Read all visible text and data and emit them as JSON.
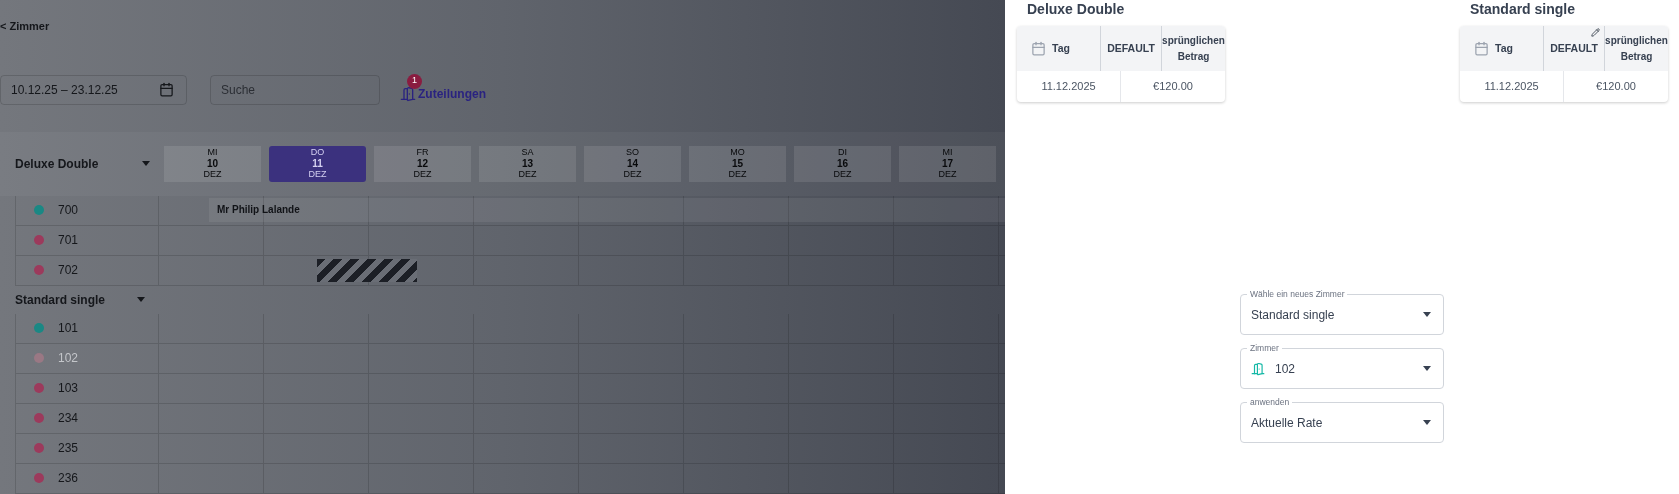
{
  "back_link": "< Zimmer",
  "toolbar": {
    "date_range": "10.12.25 – 23.12.25",
    "search": {
      "placeholder": "Suche"
    },
    "assignments": {
      "label": "Zuteilungen",
      "badge": "1"
    }
  },
  "calendar": {
    "days": [
      {
        "weekday": "MI",
        "day": "10",
        "month": "DEZ",
        "selected": false
      },
      {
        "weekday": "DO",
        "day": "11",
        "month": "DEZ",
        "selected": true
      },
      {
        "weekday": "FR",
        "day": "12",
        "month": "DEZ",
        "selected": false
      },
      {
        "weekday": "SA",
        "day": "13",
        "month": "DEZ",
        "selected": false
      },
      {
        "weekday": "SO",
        "day": "14",
        "month": "DEZ",
        "selected": false
      },
      {
        "weekday": "MO",
        "day": "15",
        "month": "DEZ",
        "selected": false
      },
      {
        "weekday": "DI",
        "day": "16",
        "month": "DEZ",
        "selected": false
      },
      {
        "weekday": "MI",
        "day": "17",
        "month": "DEZ",
        "selected": false
      }
    ],
    "groups": [
      {
        "name": "Deluxe Double",
        "rooms": [
          {
            "number": "700",
            "color": "#1a8884",
            "disabled": false,
            "blocked": false,
            "booking": "Mr Philip Lalande"
          },
          {
            "number": "701",
            "color": "#9c3a5c",
            "disabled": false,
            "blocked": false
          },
          {
            "number": "702",
            "color": "#9c3a5c",
            "disabled": false,
            "blocked": true
          }
        ]
      },
      {
        "name": "Standard single",
        "rooms": [
          {
            "number": "101",
            "color": "#1a8884",
            "disabled": false,
            "blocked": false
          },
          {
            "number": "102",
            "color": "#9a7884",
            "disabled": true,
            "blocked": false
          },
          {
            "number": "103",
            "color": "#9c3a5c",
            "disabled": false,
            "blocked": false
          },
          {
            "number": "234",
            "color": "#9c3a5c",
            "disabled": false,
            "blocked": false
          },
          {
            "number": "235",
            "color": "#9c3a5c",
            "disabled": false,
            "blocked": false
          },
          {
            "number": "236",
            "color": "#9c3a5c",
            "disabled": false,
            "blocked": false
          }
        ]
      }
    ]
  },
  "rate_tables": [
    {
      "title": "Deluxe Double",
      "editable": false,
      "columns": [
        "Tag",
        "DEFAULT",
        "sprünglichen Betrag"
      ],
      "rows": [
        {
          "date": "11.12.2025",
          "amount": "€120.00"
        }
      ]
    },
    {
      "title": "Standard single",
      "editable": true,
      "columns": [
        "Tag",
        "DEFAULT",
        "sprünglichen Betrag"
      ],
      "rows": [
        {
          "date": "11.12.2025",
          "amount": "€120.00"
        }
      ]
    }
  ],
  "form_fields": [
    {
      "kind": "select",
      "label": "Wähle ein neues Zimmer",
      "value": "Standard single"
    },
    {
      "kind": "room",
      "label": "Zimmer",
      "value": "102"
    },
    {
      "kind": "select",
      "label": "anwenden",
      "value": "Aktuelle Rate"
    }
  ]
}
